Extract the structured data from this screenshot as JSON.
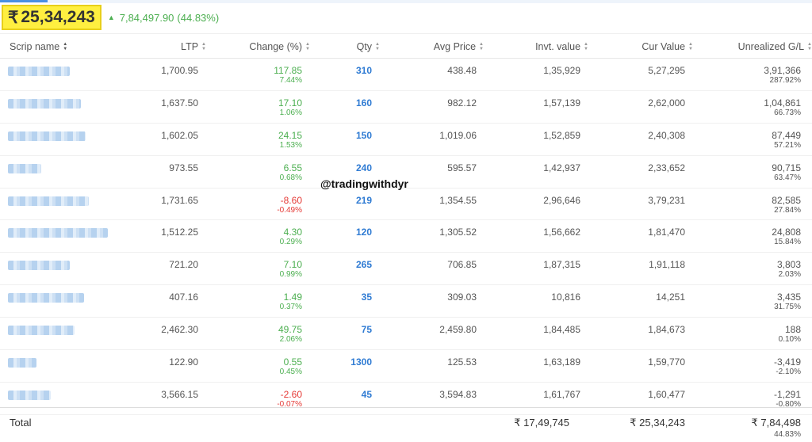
{
  "summary": {
    "rupee": "₹",
    "current_value": "25,34,243",
    "up_arrow": "▲",
    "pnl_value": "7,84,497.90",
    "pnl_percent": "(44.83%)"
  },
  "columns": [
    "Scrip name",
    "LTP",
    "Change (%)",
    "Qty",
    "Avg Price",
    "Invt. value",
    "Cur Value",
    "Unrealized G/L"
  ],
  "sort_icon": "sort-updown-icon",
  "watermark": "@tradingwithdyr",
  "rows": [
    {
      "ltp": "1,700.95",
      "change": "117.85",
      "change_pct": "7.44%",
      "dir": "pos",
      "qty": "310",
      "avg": "438.48",
      "invt": "1,35,929",
      "cur": "5,27,295",
      "gl": "3,91,366",
      "gl_pct": "287.92%"
    },
    {
      "ltp": "1,637.50",
      "change": "17.10",
      "change_pct": "1.06%",
      "dir": "pos",
      "qty": "160",
      "avg": "982.12",
      "invt": "1,57,139",
      "cur": "2,62,000",
      "gl": "1,04,861",
      "gl_pct": "66.73%"
    },
    {
      "ltp": "1,602.05",
      "change": "24.15",
      "change_pct": "1.53%",
      "dir": "pos",
      "qty": "150",
      "avg": "1,019.06",
      "invt": "1,52,859",
      "cur": "2,40,308",
      "gl": "87,449",
      "gl_pct": "57.21%"
    },
    {
      "ltp": "973.55",
      "change": "6.55",
      "change_pct": "0.68%",
      "dir": "pos",
      "qty": "240",
      "avg": "595.57",
      "invt": "1,42,937",
      "cur": "2,33,652",
      "gl": "90,715",
      "gl_pct": "63.47%"
    },
    {
      "ltp": "1,731.65",
      "change": "-8.60",
      "change_pct": "-0.49%",
      "dir": "neg",
      "qty": "219",
      "avg": "1,354.55",
      "invt": "2,96,646",
      "cur": "3,79,231",
      "gl": "82,585",
      "gl_pct": "27.84%"
    },
    {
      "ltp": "1,512.25",
      "change": "4.30",
      "change_pct": "0.29%",
      "dir": "pos",
      "qty": "120",
      "avg": "1,305.52",
      "invt": "1,56,662",
      "cur": "1,81,470",
      "gl": "24,808",
      "gl_pct": "15.84%"
    },
    {
      "ltp": "721.20",
      "change": "7.10",
      "change_pct": "0.99%",
      "dir": "pos",
      "qty": "265",
      "avg": "706.85",
      "invt": "1,87,315",
      "cur": "1,91,118",
      "gl": "3,803",
      "gl_pct": "2.03%"
    },
    {
      "ltp": "407.16",
      "change": "1.49",
      "change_pct": "0.37%",
      "dir": "pos",
      "qty": "35",
      "avg": "309.03",
      "invt": "10,816",
      "cur": "14,251",
      "gl": "3,435",
      "gl_pct": "31.75%"
    },
    {
      "ltp": "2,462.30",
      "change": "49.75",
      "change_pct": "2.06%",
      "dir": "pos",
      "qty": "75",
      "avg": "2,459.80",
      "invt": "1,84,485",
      "cur": "1,84,673",
      "gl": "188",
      "gl_pct": "0.10%"
    },
    {
      "ltp": "122.90",
      "change": "0.55",
      "change_pct": "0.45%",
      "dir": "pos",
      "qty": "1300",
      "avg": "125.53",
      "invt": "1,63,189",
      "cur": "1,59,770",
      "gl": "-3,419",
      "gl_pct": "-2.10%"
    },
    {
      "ltp": "3,566.15",
      "change": "-2.60",
      "change_pct": "-0.07%",
      "dir": "neg",
      "qty": "45",
      "avg": "3,594.83",
      "invt": "1,61,767",
      "cur": "1,60,477",
      "gl": "-1,291",
      "gl_pct": "-0.80%"
    }
  ],
  "total": {
    "label": "Total",
    "invt": "₹ 17,49,745",
    "cur": "₹ 25,34,243",
    "gl": "₹ 7,84,498",
    "gl_pct": "44.83%"
  },
  "colors": {
    "positive": "#4caf50",
    "negative": "#e53935",
    "qty": "#2f7bd3",
    "highlight": "#ffef40"
  }
}
